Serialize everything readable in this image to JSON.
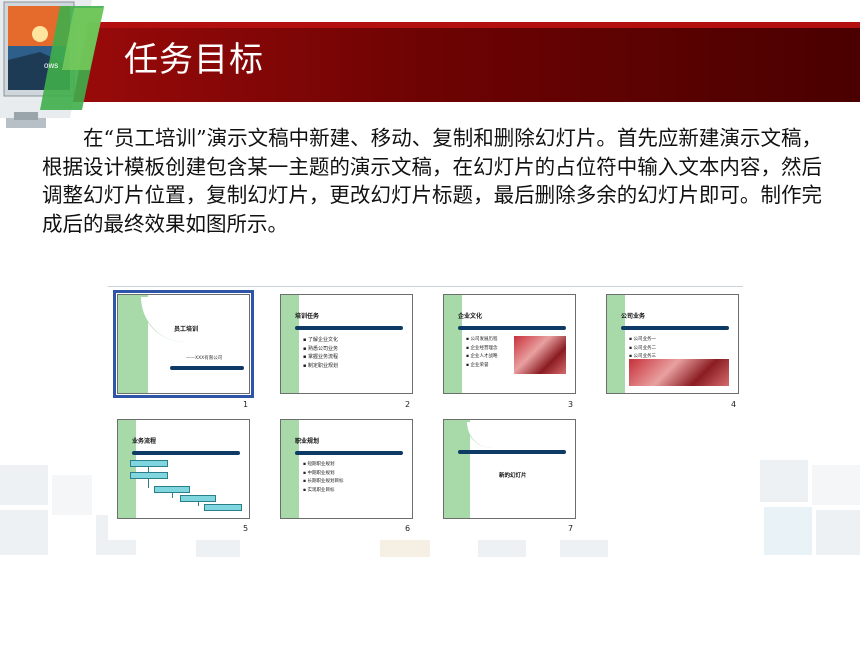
{
  "header": {
    "title": "任务目标"
  },
  "description": "在“员工培训”演示文稿中新建、移动、复制和删除幻灯片。首先应新建演示文稿，根据设计模板创建包含某一主题的演示文稿，在幻灯片的占位符中输入文本内容，然后调整幻灯片位置，复制幻灯片，更改幻灯片标题，最后删除多余的幻灯片即可。制作完成后的最终效果如图所示。",
  "slides": [
    {
      "number": "1",
      "title": "员工培训",
      "subtitle": "——XXX有限公司"
    },
    {
      "number": "2",
      "title": "培训任务",
      "bullets": [
        "了解企业文化",
        "熟悉公司业务",
        "掌握业务流程",
        "制定职业规划"
      ]
    },
    {
      "number": "3",
      "title": "企业文化",
      "bullets": [
        "公司发展历程",
        "企业经营理念",
        "企业人才战略",
        "企业荣誉"
      ]
    },
    {
      "number": "4",
      "title": "公司业务",
      "bullets": [
        "公司业务一",
        "公司业务二",
        "公司业务三",
        "公司业务四"
      ]
    },
    {
      "number": "5",
      "title": "业务流程"
    },
    {
      "number": "6",
      "title": "职业规划",
      "bullets": [
        "短期职业规划",
        "中期职业规划",
        "长期职业规划目标",
        "实现职业目标"
      ]
    },
    {
      "number": "7",
      "title": "新的幻灯片"
    }
  ],
  "colors": {
    "banner": "#7a0505",
    "slide_bar": "#0e3a66",
    "slide_green": "#a7d9a9",
    "selection": "#2e55a8"
  }
}
